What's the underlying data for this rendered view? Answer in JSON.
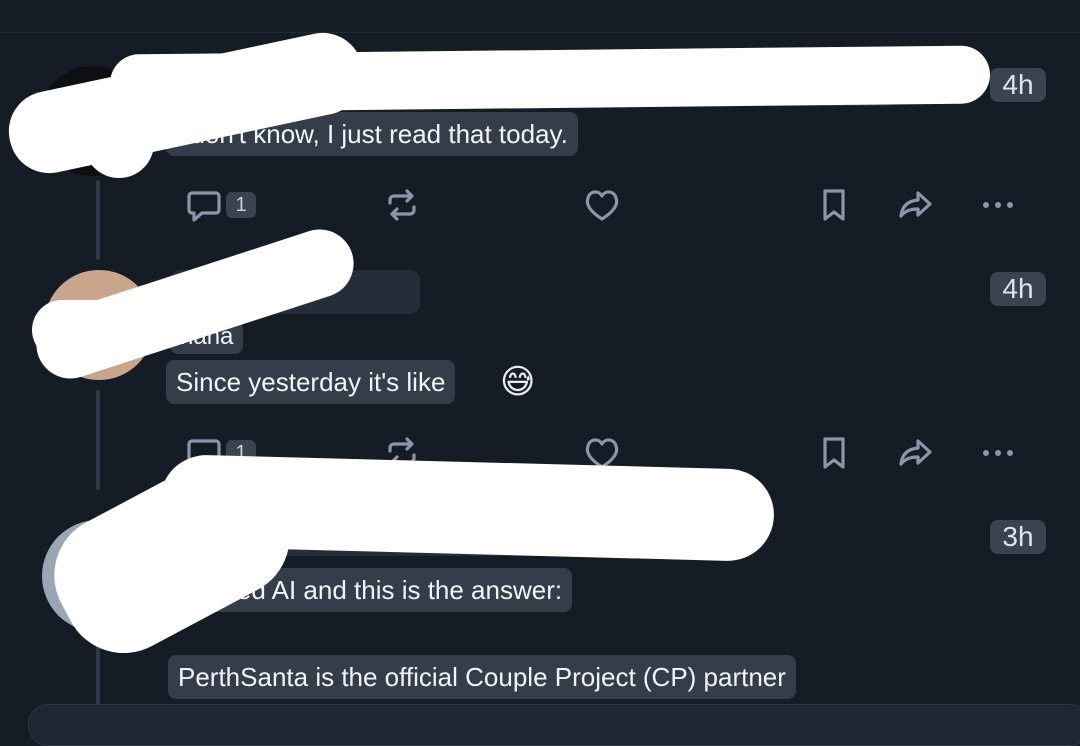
{
  "posts": [
    {
      "time": "4h",
      "lines": [
        "I don't know, I just read that today."
      ],
      "actions": {
        "reply_count": "1"
      }
    },
    {
      "time": "4h",
      "lines": [
        "haha",
        "Since yesterday it's like"
      ],
      "emoji": "😅",
      "actions": {
        "reply_count": "1"
      }
    },
    {
      "time": "3h",
      "lines": [
        "I asked AI and this is the answer:",
        "PerthSanta is the official Couple Project (CP) partner"
      ]
    }
  ],
  "colors": {
    "background": "#161c26",
    "chip": "#363d4a",
    "icon": "#8a96aa",
    "thread_line": "#313a48"
  }
}
